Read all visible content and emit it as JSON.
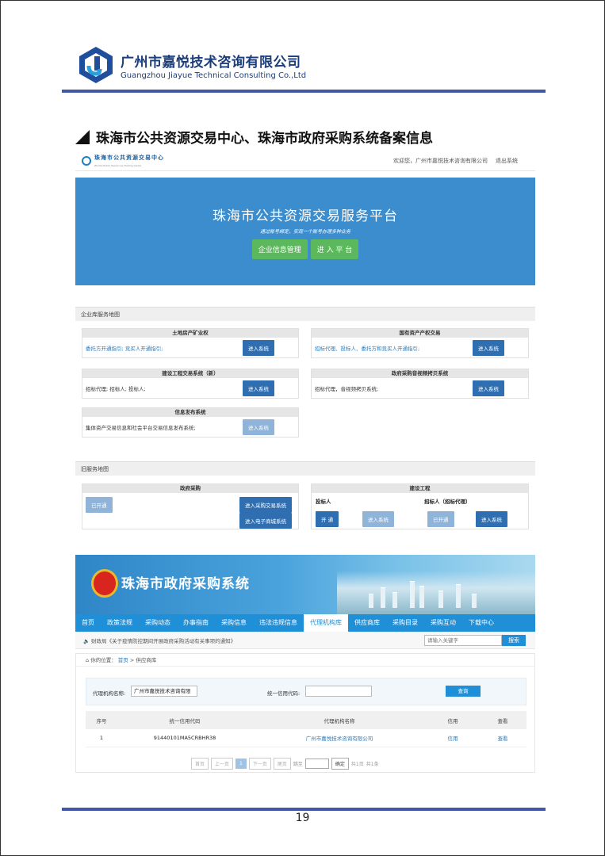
{
  "header": {
    "company_cn": "广州市嘉悦技术咨询有限公司",
    "company_en": "Guangzhou Jiayue Technical Consulting Co.,Ltd",
    "logo_icon": "jiayue-logo-icon"
  },
  "section_title": "珠海市公共资源交易中心、珠海市政府采购系统备案信息",
  "screenshot1": {
    "site_name": "珠海市公共资源交易中心",
    "site_name_en": "Zhuhai Public Resources Trading Center",
    "welcome": "欢迎您，广州市嘉悦技术咨询有限公司",
    "logout": "退出系统",
    "banner_title": "珠海市公共资源交易服务平台",
    "banner_sub": "通过账号绑定，实现一个账号办理多种业务",
    "btn_company": "企业信息管理",
    "btn_enter": "进 入 平 台",
    "panel1": "企业库服务地图",
    "panel2": "旧服务地图",
    "enter_label": "进入系统",
    "boxes": {
      "land_title": "土地房产矿业权",
      "land_text": "委托方开通指引; 竞买人开通指引;",
      "state_title": "国有资产产权交易",
      "state_text": "招标代理、投标人、委托方和竞买人开通指引;",
      "build_title": "建设工程交易系统（新）",
      "build_text": "招标代理; 招标人; 投标人;",
      "video_title": "政府采购音视频拷贝系统",
      "video_text": "招标代理，音视频拷贝系统;",
      "info_title": "信息发布系统",
      "info_text": "集体资产交易信息和社会平台交易信息发布系统;"
    },
    "old": {
      "gov_title": "政府采购",
      "opened": "已开通",
      "enter_purchase": "进入采购交易系统",
      "enter_mall": "进入电子商城系统",
      "build_title": "建设工程",
      "bidder": "投标人",
      "tenderer": "招标人（招标代理）",
      "open": "开 通",
      "enter": "进入系统",
      "opened2": "已开通",
      "enter2": "进入系统"
    }
  },
  "screenshot2": {
    "title": "珠海市政府采购系统",
    "nav": [
      "首页",
      "政策法规",
      "采购动态",
      "办事指南",
      "采购信息",
      "违法违规信息",
      "代理机构库",
      "供应商库",
      "采购目录",
      "采购互动",
      "下载中心"
    ],
    "nav_active": 6,
    "notice": "财政局《关于疫情防控期间开展政府采购活动有关事项的通知》",
    "search_placeholder": "请输入关键字",
    "search_btn": "搜索",
    "crumb_prefix": "你的位置：",
    "crumb_home": "首页",
    "crumb_current": "> 供应商库",
    "q_name_label": "代理机构名称:",
    "q_name_value": "广州市嘉悦技术咨询有限",
    "q_code_label": "统一信用代码:",
    "q_btn": "查询",
    "table_head": [
      "序号",
      "统一信用代码",
      "代理机构名称",
      "信用",
      "查看"
    ],
    "table_row": [
      "1",
      "91440101MA5CRBHR38",
      "广州市嘉悦技术咨询有限公司",
      "信用",
      "查看"
    ],
    "pager": [
      "首页",
      "上一页",
      "1",
      "下一页",
      "尾页",
      "跳至",
      "确定",
      "共1页",
      "共1条"
    ]
  },
  "page_number": "19"
}
